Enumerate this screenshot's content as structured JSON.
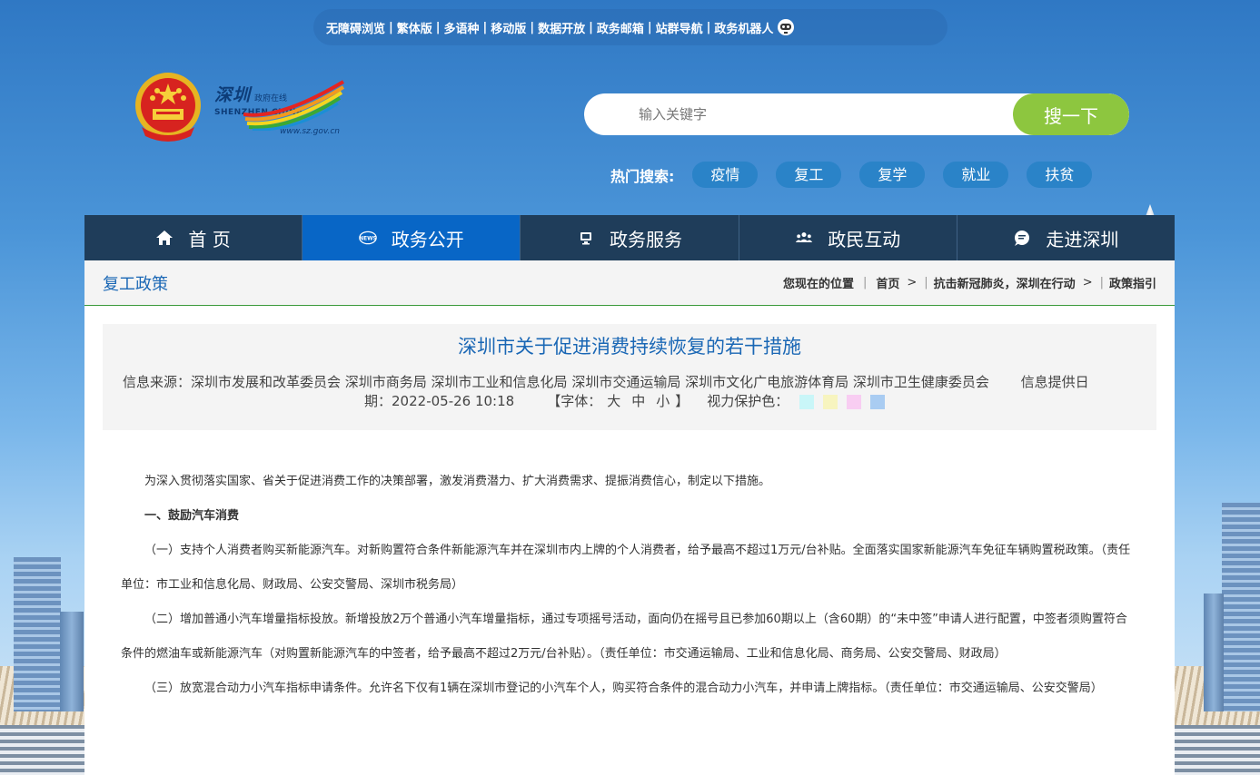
{
  "toolbar": {
    "items": [
      "无障碍浏览",
      "繁体版",
      "多语种",
      "移动版",
      "数据开放",
      "政务邮箱",
      "站群导航",
      "政务机器人"
    ]
  },
  "logo": {
    "cn": "深圳",
    "cn_sub": "政府在线",
    "en": "SHENZHEN CHINA",
    "url": "www.sz.gov.cn"
  },
  "search": {
    "placeholder": "输入关键字",
    "button_label": "搜一下"
  },
  "hot_search": {
    "label": "热门搜索:",
    "tags": [
      "疫情",
      "复工",
      "复学",
      "就业",
      "扶贫"
    ]
  },
  "nav": {
    "items": [
      {
        "label": "首 页",
        "icon": "home-icon"
      },
      {
        "label": "政务公开",
        "icon": "news-icon"
      },
      {
        "label": "政务服务",
        "icon": "monitor-icon"
      },
      {
        "label": "政民互动",
        "icon": "people-icon"
      },
      {
        "label": "走进深圳",
        "icon": "chat-icon"
      }
    ],
    "active_index": 1
  },
  "crumbbar": {
    "section_title": "复工政策",
    "location_label": "您现在的位置",
    "crumbs": [
      "首页",
      "抗击新冠肺炎，深圳在行动",
      "政策指引"
    ]
  },
  "article": {
    "title": "深圳市关于促进消费持续恢复的若干措施",
    "source_label": "信息来源：",
    "source_value": "深圳市发展和改革委员会 深圳市商务局 深圳市工业和信息化局 深圳市交通运输局 深圳市文化广电旅游体育局 深圳市卫生健康委员会",
    "date_label_a": "信息提供日",
    "date_label_b": "期：",
    "date_value": "2022-05-26 10:18",
    "font_label": "【字体：",
    "font_sizes": [
      "大",
      "中",
      "小"
    ],
    "font_close": "】",
    "eye_label": "视力保护色：",
    "eye_colors": [
      "#c9f6f8",
      "#f7f4bf",
      "#f8cdf2",
      "#a9ccf2"
    ],
    "paragraphs": [
      "为深入贯彻落实国家、省关于促进消费工作的决策部署，激发消费潜力、扩大消费需求、提振消费信心，制定以下措施。",
      "一、鼓励汽车消费",
      "（一）支持个人消费者购买新能源汽车。对新购置符合条件新能源汽车并在深圳市内上牌的个人消费者，给予最高不超过1万元/台补贴。全面落实国家新能源汽车免征车辆购置税政策。（责任单位：市工业和信息化局、财政局、公安交警局、深圳市税务局）",
      "（二）增加普通小汽车增量指标投放。新增投放2万个普通小汽车增量指标，通过专项摇号活动，面向仍在摇号且已参加60期以上（含60期）的“未中签”申请人进行配置，中签者须购置符合条件的燃油车或新能源汽车（对购置新能源汽车的中签者，给予最高不超过2万元/台补贴）。（责任单位：市交通运输局、工业和信息化局、商务局、公安交警局、财政局）",
      "（三）放宽混合动力小汽车指标申请条件。允许名下仅有1辆在深圳市登记的小汽车个人，购买符合条件的混合动力小汽车，并申请上牌指标。（责任单位：市交通运输局、公安交警局）"
    ]
  },
  "colors": {
    "nav_bg": "#1f3d5a",
    "nav_active": "#0866c6",
    "search_btn": "#8dc63f",
    "hot_tag": "#2a83c8",
    "title_blue": "#1a67b5"
  }
}
